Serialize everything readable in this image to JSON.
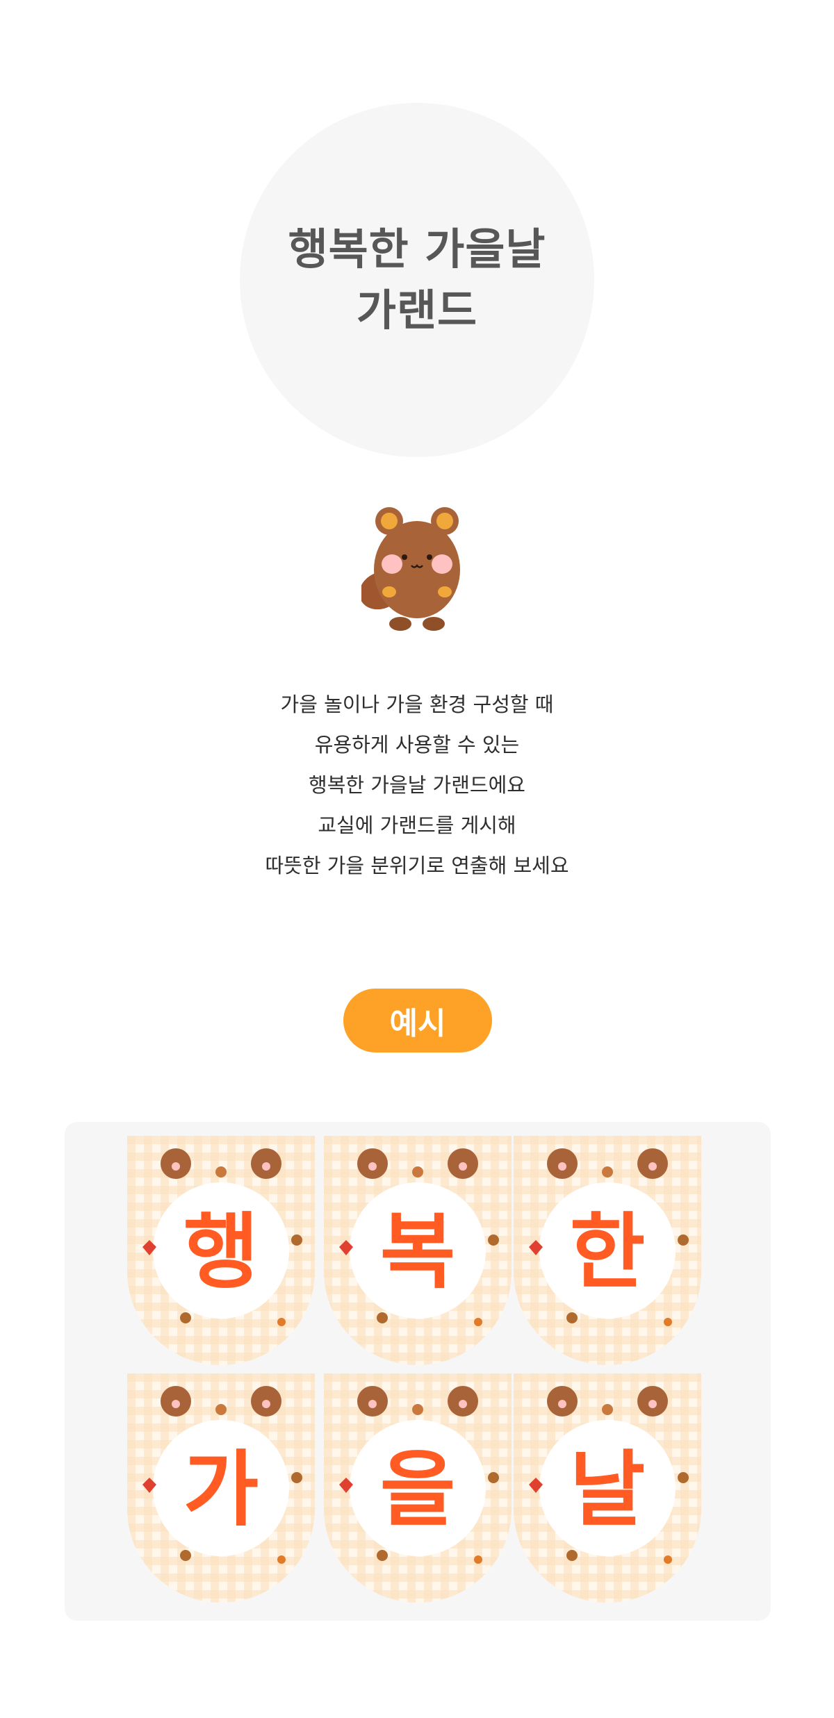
{
  "hero": {
    "title_line1": "행복한 가을날",
    "title_line2": "가랜드"
  },
  "mascot": {
    "icon": "beaver-mascot-icon"
  },
  "description": {
    "lines": [
      "가을 놀이나 가을 환경 구성할 때",
      "유용하게 사용할 수 있는",
      "행복한 가을날 가랜드에요",
      "교실에 가랜드를 게시해",
      "따뜻한 가을 분위기로 연출해 보세요"
    ]
  },
  "example": {
    "badge_label": "예시",
    "pennants": [
      "행",
      "복",
      "한",
      "가",
      "을",
      "날"
    ]
  },
  "colors": {
    "badge": "#fda227",
    "letter": "#ff5b22",
    "check": "#fde3c4",
    "panel": "#f6f6f6"
  }
}
